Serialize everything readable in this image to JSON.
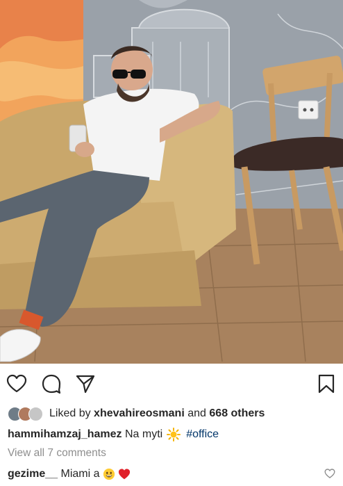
{
  "post": {
    "liked_prefix": "Liked by",
    "liked_user": "xhevahireosmani",
    "liked_and": "and",
    "liked_count": "668 others",
    "caption_user": "hammihamzaj_hamez",
    "caption_text": "Na myti",
    "caption_tag": "#office",
    "view_comments": "View all 7 comments",
    "comment_user": "gezime__",
    "comment_text": "Miami a"
  },
  "icons": {
    "like": "heart-outline-icon",
    "comment": "comment-bubble-icon",
    "share": "paper-plane-icon",
    "save": "bookmark-icon",
    "comment_like": "small-heart-icon"
  },
  "colors": {
    "link": "#003569",
    "muted": "#8e8e8e",
    "text": "#262626"
  }
}
